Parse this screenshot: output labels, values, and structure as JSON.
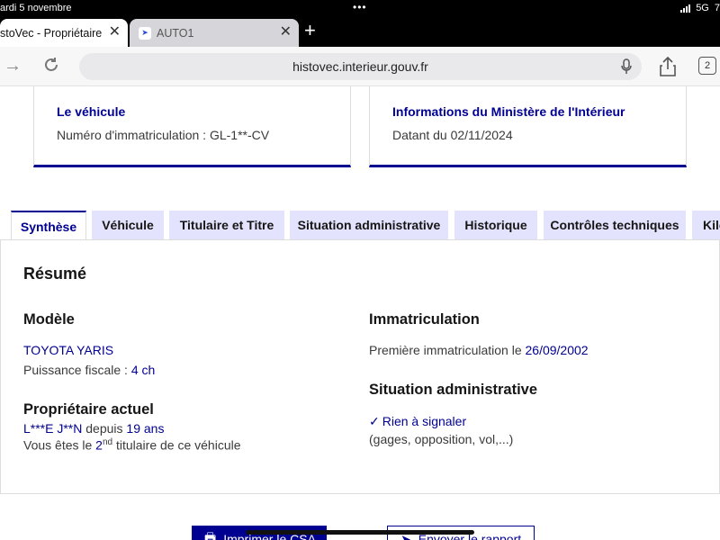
{
  "status": {
    "time": "ardi 5 novembre",
    "dots": "•••",
    "network": "5G",
    "battery": "7"
  },
  "browser_tabs": [
    {
      "title": "stoVec - Propriétaire",
      "active": true
    },
    {
      "title": "AUTO1",
      "active": false
    }
  ],
  "address": {
    "url": "histovec.interieur.gouv.fr",
    "tab_count": "2"
  },
  "cards": [
    {
      "title": "Le véhicule",
      "text": "Numéro d'immatriculation : GL-1**-CV"
    },
    {
      "title": "Informations du Ministère de l'Intérieur",
      "text": "Datant du 02/11/2024"
    }
  ],
  "tabs": [
    "Synthèse",
    "Véhicule",
    "Titulaire et Titre",
    "Situation administrative",
    "Historique",
    "Contrôles techniques",
    "Kilo"
  ],
  "resume": {
    "title": "Résumé",
    "model": {
      "heading": "Modèle",
      "name": "TOYOTA YARIS",
      "power_label": "Puissance fiscale : ",
      "power_value": "4 ch"
    },
    "owner": {
      "heading": "Propriétaire actuel",
      "name": "L***E J**N",
      "since_label": " depuis ",
      "since_value": "19 ans",
      "rank_prefix": "Vous êtes le ",
      "rank_num": "2",
      "rank_sup": "nd",
      "rank_suffix": " titulaire de ce véhicule"
    },
    "registration": {
      "heading": "Immatriculation",
      "label": "Première immatriculation le ",
      "date": "26/09/2002"
    },
    "admin": {
      "heading": "Situation administrative",
      "status": "Rien à signaler",
      "details": "(gages, opposition, vol,...)"
    }
  },
  "buttons": {
    "print": "Imprimer le CSA",
    "send": "Envoyer le rapport"
  }
}
